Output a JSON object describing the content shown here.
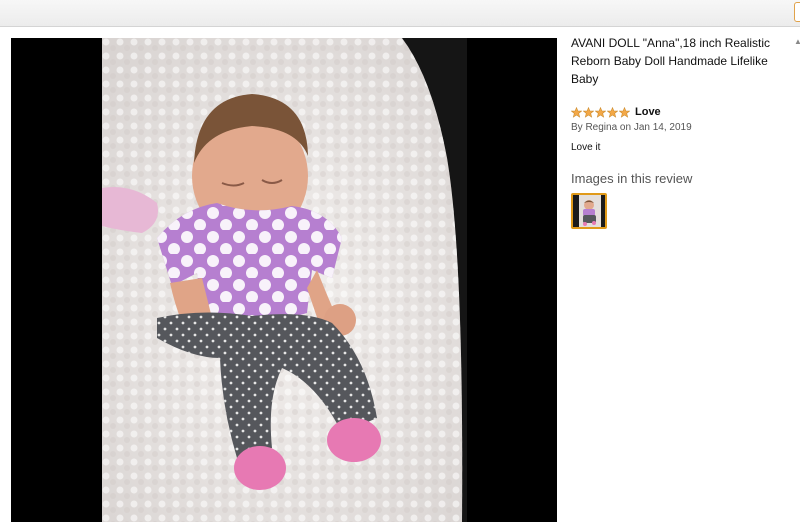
{
  "review": {
    "product_title": "AVANI DOLL \"Anna\",18 inch Realistic Reborn Baby Doll Handmade Lifelike Baby",
    "rating": 5,
    "rating_max": 5,
    "headline": "Love",
    "byline": "By Regina on Jan 14, 2019",
    "body": "Love it",
    "images_label": "Images in this review"
  },
  "colors": {
    "star_fill": "#f3a847",
    "thumb_border": "#e09a1a"
  }
}
